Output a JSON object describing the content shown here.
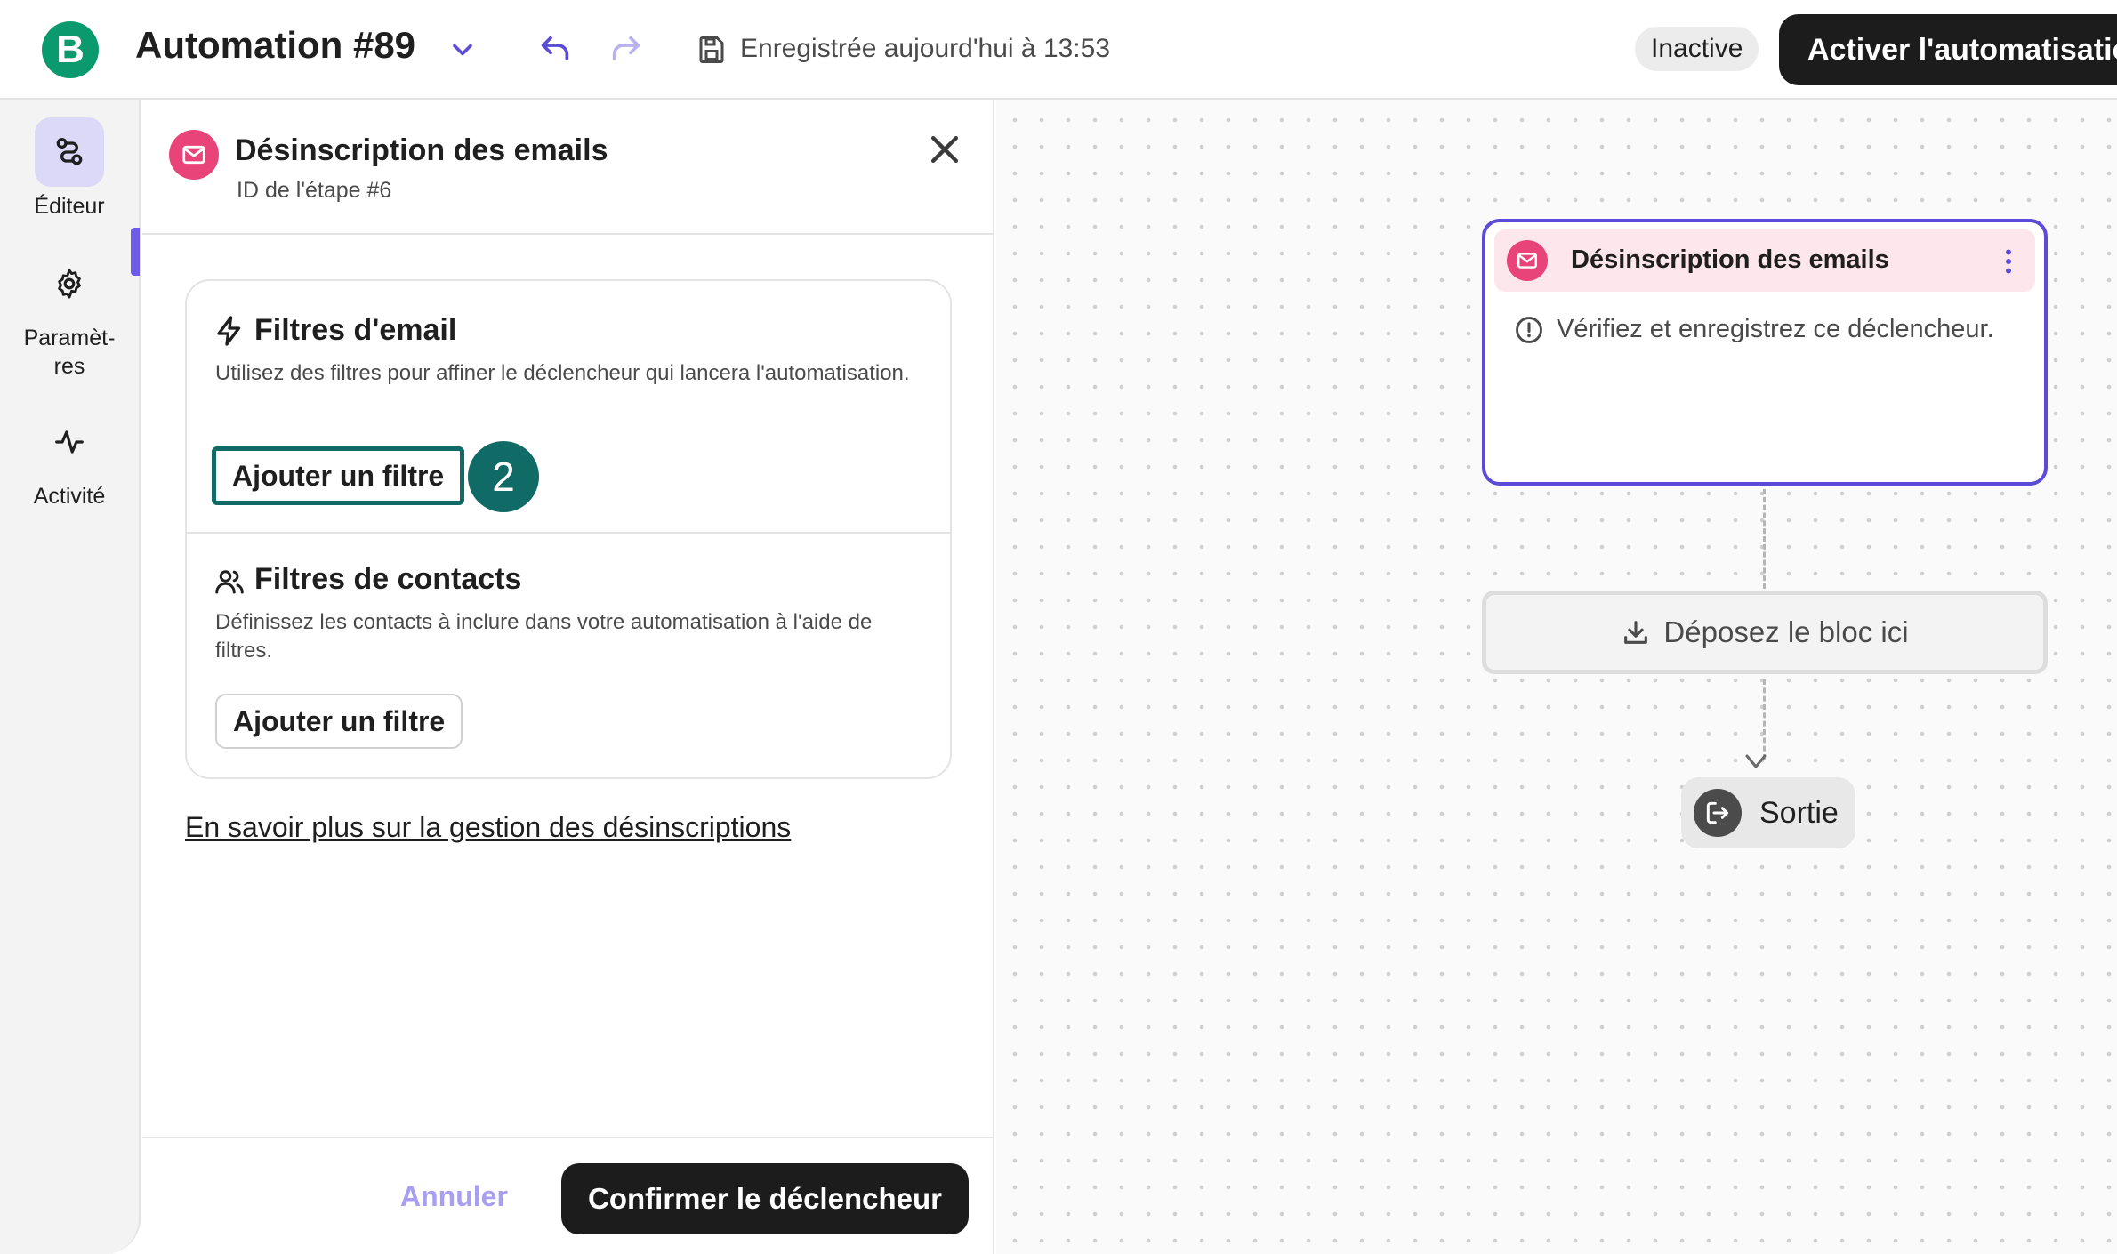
{
  "header": {
    "logo_letter": "B",
    "title": "Automation #89",
    "saved_status": "Enregistrée aujourd'hui à 13:53",
    "status_badge": "Inactive",
    "activate_label": "Activer l'automatisation"
  },
  "sidebar": {
    "items": [
      {
        "label": "Éditeur",
        "icon": "workflow-icon",
        "active": true
      },
      {
        "label": "Paramèt-res",
        "icon": "gear-icon",
        "active": false
      },
      {
        "label": "Activité",
        "icon": "activity-icon",
        "active": false
      }
    ]
  },
  "panel": {
    "title": "Désinscription des emails",
    "subtitle": "ID de l'étape #6",
    "email_filters": {
      "title": "Filtres d'email",
      "description": "Utilisez des filtres pour affiner le déclencheur qui lancera l'automatisation.",
      "button": "Ajouter un filtre",
      "step_number": "2"
    },
    "contact_filters": {
      "title": "Filtres de contacts",
      "description": "Définissez les contacts à inclure dans votre automatisation à l'aide de filtres.",
      "button": "Ajouter un filtre"
    },
    "learn_more": "En savoir plus sur la gestion des désinscriptions",
    "cancel_label": "Annuler",
    "confirm_label": "Confirmer le déclencheur"
  },
  "canvas": {
    "trigger": {
      "title": "Désinscription des emails",
      "warning": "Vérifiez et enregistrez ce déclencheur."
    },
    "drop_zone": "Déposez le bloc ici",
    "exit_label": "Sortie"
  },
  "colors": {
    "brand_green": "#0b9a6d",
    "accent_purple": "#5b4bd8",
    "email_pink": "#e9447a",
    "highlight_teal": "#106a66"
  }
}
